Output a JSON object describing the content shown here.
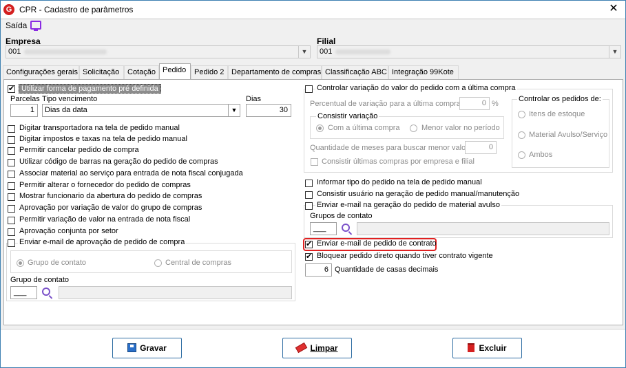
{
  "window": {
    "title": "CPR - Cadastro de parâmetros"
  },
  "menu": {
    "saida": "Saída"
  },
  "empresa": {
    "label": "Empresa",
    "value": "001"
  },
  "filial": {
    "label": "Filial",
    "value": "001"
  },
  "tabs": [
    "Configurações gerais",
    "Solicitação",
    "Cotação",
    "Pedido",
    "Pedido 2",
    "Departamento de compras",
    "Classificação ABC",
    "Integração 99Kote"
  ],
  "left": {
    "utilizar_forma": "Utilizar forma de pagamento pré definida",
    "parcelas_label": "Parcelas",
    "parcelas_value": "1",
    "tipo_venc_label": "Tipo vencimento",
    "tipo_venc_value": "Dias da data",
    "dias_label": "Dias",
    "dias_value": "30",
    "options": [
      "Digitar transportadora na tela de pedido manual",
      "Digitar impostos e taxas na tela de pedido manual",
      "Permitir cancelar pedido de compra",
      "Utilizar código de barras na geração do pedido de compras",
      "Associar material ao serviço para entrada de nota fiscal conjugada",
      "Permitir alterar o fornecedor do pedido de compras",
      "Mostrar funcionario da abertura do pedido de compras",
      "Aprovação por variação de valor do grupo de compras",
      "Permitir variação de valor na entrada de nota fiscal",
      "Aprovação conjunta por setor",
      "Enviar e-mail de aprovação de pedido de compra"
    ],
    "radio_grupo": "Grupo de contato",
    "radio_central": "Central de compras",
    "grupo_contato_label": "Grupo de contato"
  },
  "right": {
    "controlar_variacao": "Controlar variação do valor do pedido com a última compra",
    "percentual_label": "Percentual de variação para a última compra",
    "percentual_value": "0",
    "percent_sign": "%",
    "consistir_variacao": "Consistir variação",
    "radio_ultima": "Com a última compra",
    "radio_menor": "Menor valor no período",
    "qtd_meses_label": "Quantidade de meses para buscar menor valor",
    "qtd_meses_value": "0",
    "consistir_ultimas": "Consistir últimas compras por empresa e filial",
    "controlar_pedidos": "Controlar os pedidos de:",
    "radio_itens": "Itens de estoque",
    "radio_material": "Material Avulso/Serviço",
    "radio_ambos": "Ambos",
    "informar_tipo": "Informar tipo do pedido na tela de pedido manual",
    "consistir_usuario": "Consistir usuário na geração de pedido manual/manutenção",
    "enviar_avulso": "Enviar e-mail na geração do pedido de material avulso",
    "grupos_contato_label": "Grupos de contato",
    "enviar_contrato": "Enviar e-mail de pedido de contrato",
    "bloquear_pedido": "Bloquear pedido direto quando tiver contrato vigente",
    "casas_value": "6",
    "casas_label": "Quantidade de casas decimais"
  },
  "buttons": {
    "gravar": "Gravar",
    "limpar": "Limpar",
    "excluir": "Excluir"
  },
  "colors": {
    "accent": "#2d6ca2",
    "highlight": "#e02020"
  }
}
